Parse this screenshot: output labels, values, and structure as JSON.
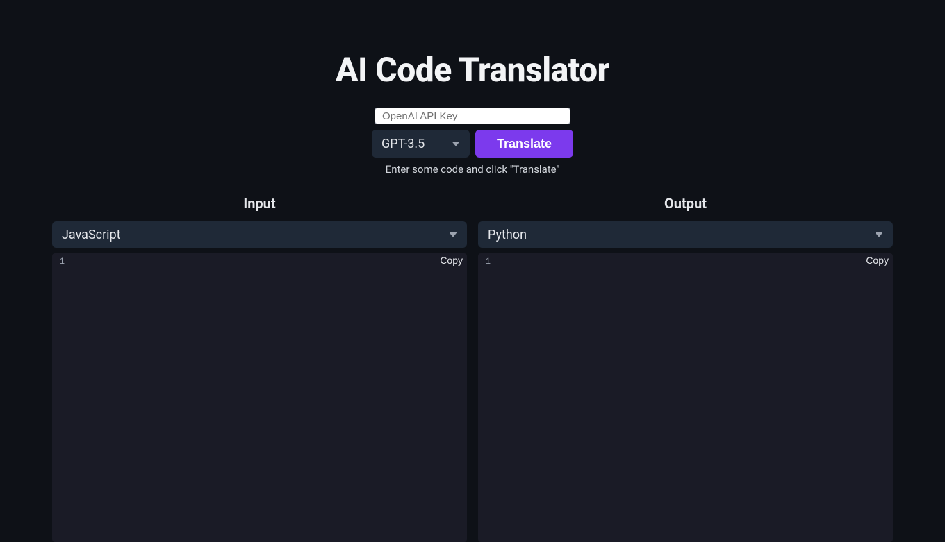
{
  "title": "AI Code Translator",
  "apiKeyPlaceholder": "OpenAI API Key",
  "model": {
    "selected": "GPT-3.5"
  },
  "translateButton": "Translate",
  "hint": "Enter some code and click \"Translate\"",
  "input": {
    "heading": "Input",
    "language": "JavaScript",
    "lineNumber": "1",
    "copyLabel": "Copy"
  },
  "output": {
    "heading": "Output",
    "language": "Python",
    "lineNumber": "1",
    "copyLabel": "Copy"
  }
}
